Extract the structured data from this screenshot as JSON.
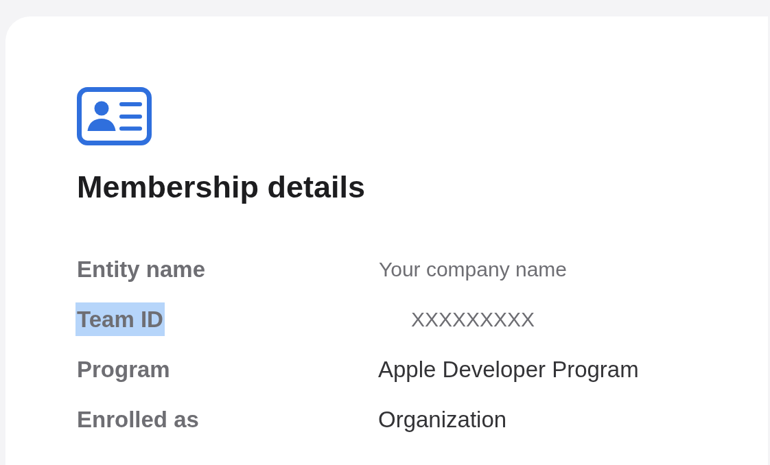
{
  "card": {
    "title": "Membership details",
    "rows": [
      {
        "label": "Entity name",
        "value": "Your company name",
        "kind": "sample",
        "highlighted": false
      },
      {
        "label": "Team ID",
        "value": "XXXXXXXXX",
        "kind": "sample",
        "highlighted": true
      },
      {
        "label": "Program",
        "value": "Apple Developer Program",
        "kind": "plain",
        "highlighted": false
      },
      {
        "label": "Enrolled as",
        "value": "Organization",
        "kind": "plain",
        "highlighted": false
      }
    ]
  }
}
